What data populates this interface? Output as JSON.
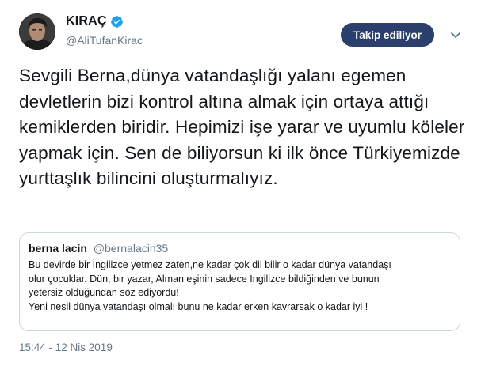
{
  "author": {
    "display_name": "KIRAÇ",
    "handle": "@AliTufanKirac",
    "follow_button": "Takip ediliyor"
  },
  "tweet": {
    "text": "Sevgili Berna,dünya vatandaşlığı yalanı egemen devletlerin bizi kontrol altına almak için ortaya attığı kemiklerden biridir. Hepimizi işe yarar ve uyumlu köleler yapmak için. Sen de biliyorsun ki ilk önce Türkiyemizde yurttaşlık bilincini oluşturmalıyız.",
    "timestamp": "15:44 - 12 Nis 2019"
  },
  "quoted": {
    "name": "berna lacin",
    "handle": "@bernalacin35",
    "lines": [
      "Bu devirde bir İngilizce yetmez zaten,ne kadar çok dil bilir o kadar dünya vatandaşı",
      "olur çocuklar. Dün, bir yazar, Alman eşinin sadece İngilizce bildiğinden ve bunun",
      "yetersiz olduğundan söz ediyordu!",
      "Yeni nesil dünya vatandaşı olmalı bunu ne kadar erken kavrarsak o kadar iyi !"
    ]
  },
  "colors": {
    "follow_bg": "#2b3f6c",
    "verified": "#1da1f2",
    "muted": "#657786"
  },
  "icons": [
    "verified-badge-icon",
    "chevron-down-icon"
  ]
}
